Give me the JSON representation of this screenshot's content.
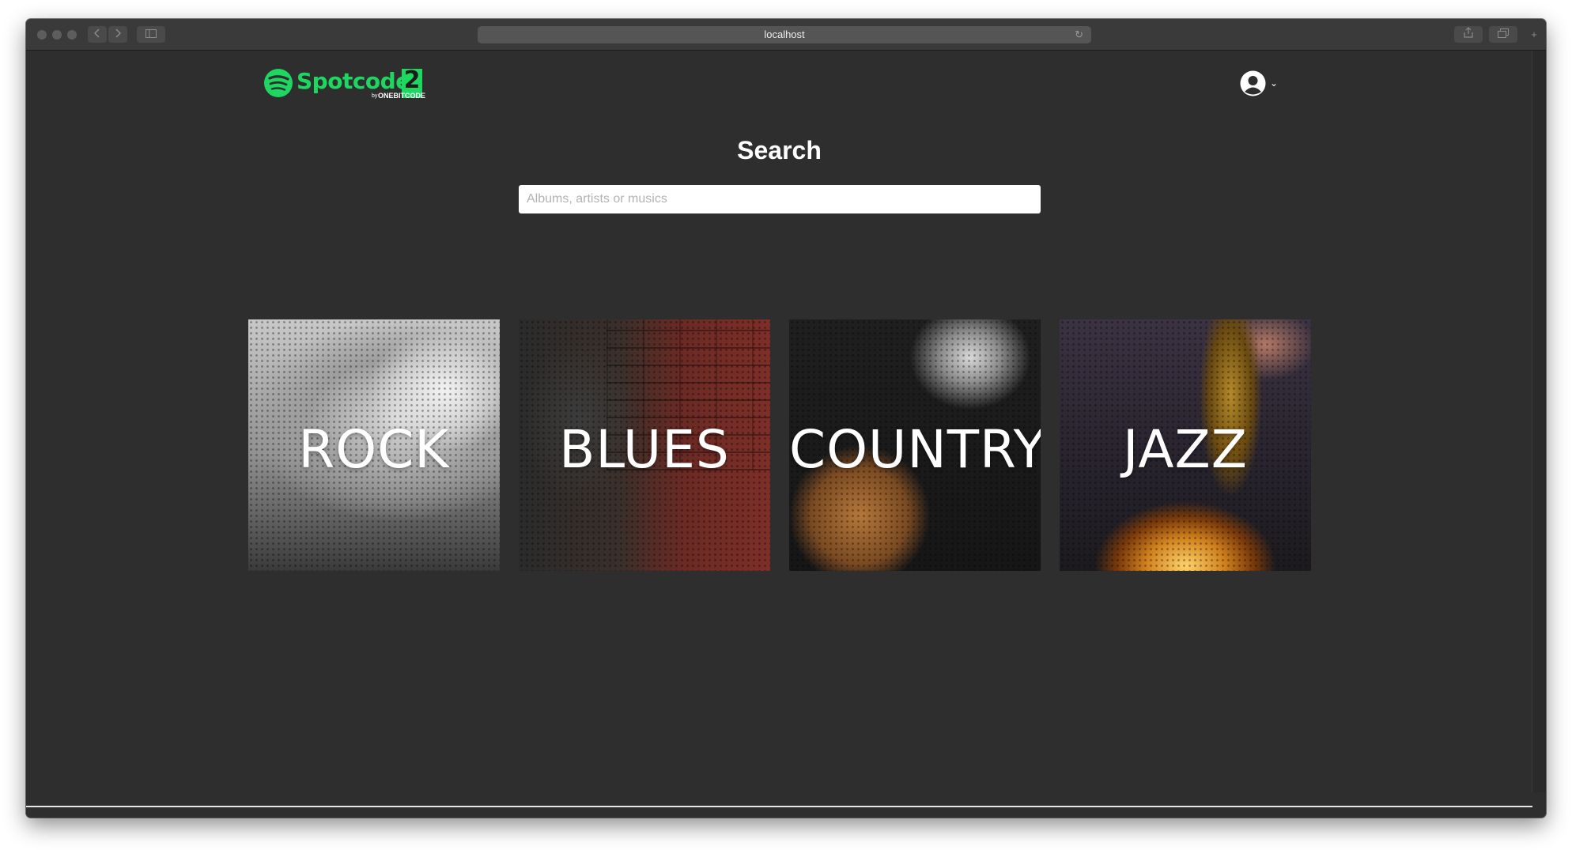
{
  "browser": {
    "address": "localhost"
  },
  "header": {
    "logo_text": "Spotcode",
    "logo_badge": "2",
    "logo_by": "by",
    "logo_brand": "ONEBITCODE"
  },
  "search": {
    "title": "Search",
    "placeholder": "Albums, artists or musics"
  },
  "genres": [
    {
      "label": "ROCK"
    },
    {
      "label": "BLUES"
    },
    {
      "label": "COUNTRY"
    },
    {
      "label": "JAZZ"
    }
  ],
  "bottom_nav": {
    "items": [
      "home-icon",
      "search-icon",
      "heart-icon"
    ]
  },
  "colors": {
    "brand": "#1ed760",
    "background": "#2e2e2e"
  }
}
